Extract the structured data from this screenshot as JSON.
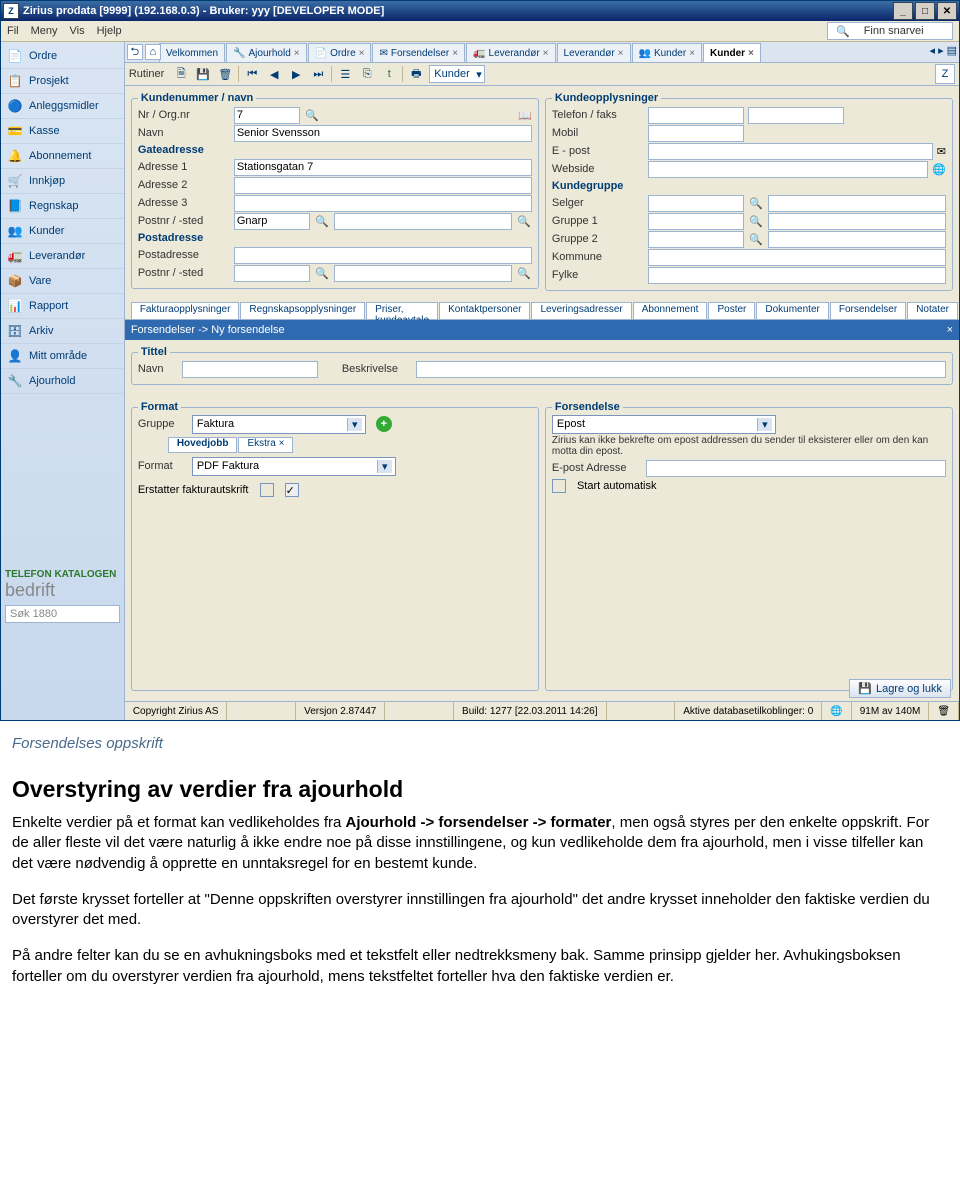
{
  "window": {
    "title": "Zirius prodata [9999] (192.168.0.3)  - Bruker: yyy [DEVELOPER MODE]",
    "menus": [
      "Fil",
      "Meny",
      "Vis",
      "Hjelp"
    ],
    "search_placeholder": "Finn snarvei"
  },
  "sidebar": {
    "items": [
      {
        "label": "Ordre",
        "icon": "📄"
      },
      {
        "label": "Prosjekt",
        "icon": "📋"
      },
      {
        "label": "Anleggsmidler",
        "icon": "🔵"
      },
      {
        "label": "Kasse",
        "icon": "💳"
      },
      {
        "label": "Abonnement",
        "icon": "🔔"
      },
      {
        "label": "Innkjøp",
        "icon": "🛒"
      },
      {
        "label": "Regnskap",
        "icon": "📘"
      },
      {
        "label": "Kunder",
        "icon": "👥"
      },
      {
        "label": "Leverandør",
        "icon": "🚛"
      },
      {
        "label": "Vare",
        "icon": "📦"
      },
      {
        "label": "Rapport",
        "icon": "📊"
      },
      {
        "label": "Arkiv",
        "icon": "🗄"
      },
      {
        "label": "Mitt område",
        "icon": "👤"
      },
      {
        "label": "Ajourhold",
        "icon": "🔧"
      }
    ],
    "footer_brand1": "TELEFON KATALOGEN",
    "footer_brand2": "bedrift",
    "footer_search": "Søk 1880"
  },
  "tabs": [
    {
      "label": "Velkommen"
    },
    {
      "label": "Ajourhold",
      "closable": true,
      "icon": "🔧"
    },
    {
      "label": "Ordre",
      "closable": true,
      "icon": "📄"
    },
    {
      "label": "Forsendelser",
      "closable": true,
      "icon": "✉"
    },
    {
      "label": "Leverandør",
      "closable": true,
      "icon": "🚛"
    },
    {
      "label": "Leverandør",
      "closable": true
    },
    {
      "label": "Kunder",
      "closable": true,
      "icon": "👥"
    },
    {
      "label": "Kunder",
      "closable": true,
      "active": true
    }
  ],
  "toolbar": {
    "label": "Rutiner",
    "dropdown": "Kunder"
  },
  "form_left": {
    "legend": "Kundenummer / navn",
    "nr_label": "Nr / Org.nr",
    "nr_value": "7",
    "navn_label": "Navn",
    "navn_value": "Senior Svensson",
    "gate_legend": "Gateadresse",
    "a1_label": "Adresse 1",
    "a1_value": "Stationsgatan 7",
    "a2_label": "Adresse 2",
    "a3_label": "Adresse 3",
    "ps_label": "Postnr / -sted",
    "ps_value": "Gnarp",
    "post_legend": "Postadresse",
    "pa_label": "Postadresse",
    "pps_label": "Postnr / -sted"
  },
  "form_right": {
    "legend": "Kundeopplysninger",
    "tel_label": "Telefon / faks",
    "mob_label": "Mobil",
    "ep_label": "E - post",
    "web_label": "Webside",
    "grp_legend": "Kundegruppe",
    "selger_label": "Selger",
    "g1_label": "Gruppe 1",
    "g2_label": "Gruppe 2",
    "kom_label": "Kommune",
    "fyl_label": "Fylke"
  },
  "subtabs": [
    "Fakturaopplysninger",
    "Regnskapsopplysninger",
    "Priser, kundeavtale",
    "Kontaktpersoner",
    "Leveringsadresser",
    "Abonnement",
    "Poster",
    "Dokumenter",
    "Forsendelser",
    "Notater"
  ],
  "bluebar": "Forsendelser -> Ny forsendelse",
  "tittel": {
    "legend": "Tittel",
    "navn_label": "Navn",
    "besk_label": "Beskrivelse"
  },
  "format": {
    "legend": "Format",
    "gruppe_label": "Gruppe",
    "gruppe_value": "Faktura",
    "tabs": [
      "Hovedjobb",
      "Ekstra"
    ],
    "format_label": "Format",
    "format_value": "PDF Faktura",
    "erstatter": "Erstatter fakturautskrift"
  },
  "forsendelse": {
    "legend": "Forsendelse",
    "type_value": "Epost",
    "note": "Zirius kan ikke bekrefte om epost addressen du sender til eksisterer eller om den kan motta din epost.",
    "ep_label": "E-post Adresse",
    "auto": "Start automatisk"
  },
  "save_label": "Lagre og lukk",
  "status": {
    "copyright": "Copyright Zirius AS",
    "version": "Versjon 2.87447",
    "build": "Build: 1277 [22.03.2011 14:26]",
    "db": "Aktive databasetilkoblinger: 0",
    "mem": "91M av 140M"
  },
  "article": {
    "caption": "Forsendelses oppskrift",
    "heading": "Overstyring av verdier fra ajourhold",
    "p1a": "Enkelte verdier på et format kan vedlikeholdes fra ",
    "p1b": "Ajourhold -> forsendelser -> formater",
    "p1c": ", men også styres per den enkelte oppskrift. For de aller fleste vil det være naturlig å ikke endre noe på disse innstillingene, og kun vedlikeholde dem fra ajourhold, men i visse tilfeller kan det være nødvendig å opprette en unntaksregel for en bestemt kunde.",
    "p2": "Det første krysset forteller at \"Denne oppskriften overstyrer innstillingen fra ajourhold\" det andre krysset inneholder den faktiske verdien du overstyrer det med.",
    "p3": "På andre felter kan du se en avhukningsboks med et tekstfelt eller nedtrekksmeny bak. Samme prinsipp gjelder her. Avhukingsboksen forteller om du overstyrer verdien fra ajourhold, mens tekstfeltet forteller hva den faktiske verdien er."
  }
}
